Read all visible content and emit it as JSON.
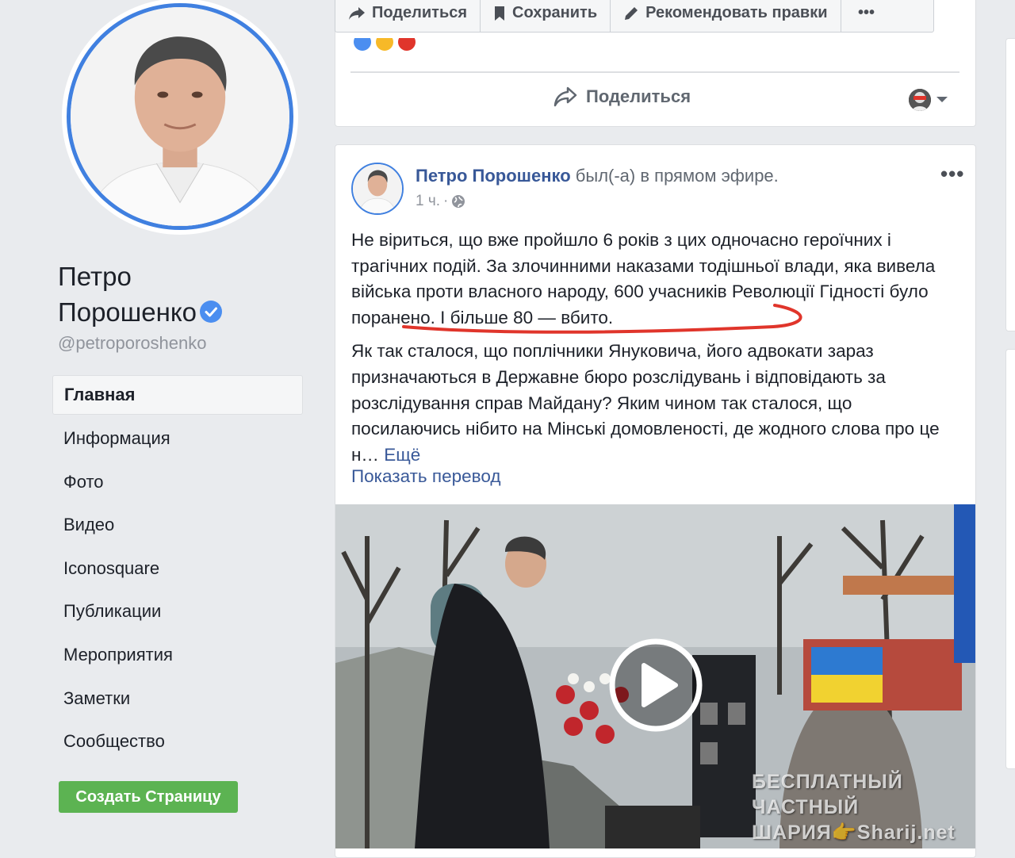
{
  "sidebar": {
    "page_name_line1": "Петро",
    "page_name_line2": "Порошенко",
    "handle": "@petroporoshenko",
    "nav": [
      {
        "label": "Главная"
      },
      {
        "label": "Информация"
      },
      {
        "label": "Фото"
      },
      {
        "label": "Видео"
      },
      {
        "label": "Iconosquare"
      },
      {
        "label": "Публикации"
      },
      {
        "label": "Мероприятия"
      },
      {
        "label": "Заметки"
      },
      {
        "label": "Сообщество"
      }
    ],
    "create_page_label": "Создать Страницу"
  },
  "topbar": {
    "share_label": "Поделиться",
    "save_label": "Сохранить",
    "suggest_label": "Рекомендовать правки",
    "more_label": "•••"
  },
  "prev_post": {
    "share_label": "Поделиться"
  },
  "post": {
    "author": "Петро Порошенко",
    "action": " был(-а) в прямом эфире.",
    "time": "1 ч.",
    "more_label": "•••",
    "paragraph1": "Не віриться, що вже пройшло 6 років з цих одночасно героїчних і трагічних подій. За злочинними наказами тодішньої влади, яка вивела війська проти власного народу, 600 учасників Революції Гідності було поранено. І більше 80 — вбито.",
    "paragraph2": "Як так сталося, що поплічники Януковича, його адвокати зараз призначаються в Державне бюро розслідувань і відповідають за розслідування справ Майдану? Яким чином так сталося, що посилаючись нібито на Мінські домовленості, де жодного слова про це н…",
    "see_more": "Ещё",
    "translate_label": "Показать перевод"
  },
  "watermark": {
    "line1": "БЕСПЛАТНЫЙ ЧАСТНЫЙ",
    "line2": "ШАРИЯ👉Sharij.net"
  },
  "colors": {
    "link": "#385898",
    "verified": "#4b8ef0",
    "create_button": "#5cb352",
    "avatar_ring": "#4080e0",
    "annotation": "#e0352b"
  }
}
